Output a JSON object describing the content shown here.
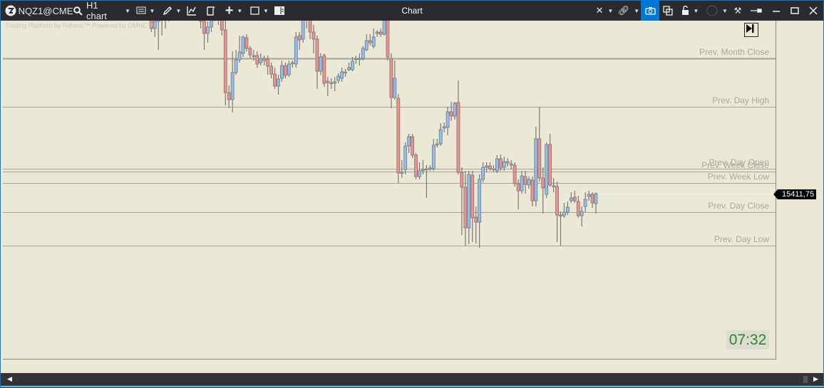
{
  "toolbar": {
    "symbol": "NQZ1@CME",
    "timeframe": "H1 chart",
    "title": "Chart"
  },
  "watermark": "Trading Platform by Rithmic™  Powered by OMNE™",
  "colors": {
    "up": "#90bef0",
    "down": "#f0908c",
    "outline": "#787878",
    "level": "#a4a39c",
    "background": "#ebe9d5",
    "titlebar": "#2b2b2f",
    "accent": "#0078d7",
    "clock": "#2a8a2a"
  },
  "levels": [
    {
      "label": "Prev. Month Close",
      "price": 15602
    },
    {
      "label": "Prev. Day High",
      "price": 15534
    },
    {
      "label": "Prev. Day Open",
      "price": 15447
    },
    {
      "label": "Prev. Week Close",
      "price": 15443
    },
    {
      "label": "Prev. Week Low",
      "price": 15427
    },
    {
      "label": "Prev. Day Close",
      "price": 15386
    },
    {
      "label": "Prev. Day Low",
      "price": 15339
    }
  ],
  "last_price": "15411,75",
  "clock": "07:32",
  "chart_data": {
    "type": "candlestick",
    "timeframe": "H1",
    "last": 15411.75,
    "ohlc": [
      [
        15664,
        15672,
        15639,
        15644
      ],
      [
        15644,
        15659,
        15632,
        15654
      ],
      [
        15654,
        15669,
        15614,
        15664
      ],
      [
        15664,
        15674,
        15634,
        15656
      ],
      [
        15656,
        15679,
        15644,
        15669
      ],
      [
        15669,
        15694,
        15654,
        15679
      ],
      [
        15679,
        15704,
        15664,
        15689
      ],
      [
        15689,
        15704,
        15669,
        15684
      ],
      [
        15684,
        15709,
        15674,
        15694
      ],
      [
        15694,
        15709,
        15674,
        15689
      ],
      [
        15689,
        15714,
        15679,
        15699
      ],
      [
        15699,
        15714,
        15679,
        15694
      ],
      [
        15694,
        15704,
        15669,
        15684
      ],
      [
        15684,
        15694,
        15659,
        15674
      ],
      [
        15674,
        15684,
        15644,
        15654
      ],
      [
        15654,
        15664,
        15614,
        15637
      ],
      [
        15637,
        15654,
        15624,
        15646
      ],
      [
        15646,
        15674,
        15639,
        15664
      ],
      [
        15664,
        15684,
        15654,
        15674
      ],
      [
        15674,
        15684,
        15649,
        15659
      ],
      [
        15659,
        15669,
        15634,
        15642
      ],
      [
        15642,
        15664,
        15536,
        15554
      ],
      [
        15554,
        15564,
        15532,
        15544
      ],
      [
        15544,
        15612,
        15526,
        15582
      ],
      [
        15582,
        15614,
        15579,
        15600
      ],
      [
        15600,
        15634,
        15596,
        15611
      ],
      [
        15609,
        15634,
        15604,
        15632
      ],
      [
        15631,
        15636,
        15612,
        15616
      ],
      [
        15616,
        15619,
        15602,
        15607
      ],
      [
        15606,
        15614,
        15599,
        15606
      ],
      [
        15606,
        15612,
        15589,
        15594
      ],
      [
        15596,
        15609,
        15592,
        15602
      ],
      [
        15602,
        15606,
        15592,
        15599
      ],
      [
        15601,
        15606,
        15579,
        15591
      ],
      [
        15591,
        15596,
        15574,
        15580
      ],
      [
        15580,
        15589,
        15559,
        15563
      ],
      [
        15563,
        15579,
        15551,
        15573
      ],
      [
        15574,
        15599,
        15569,
        15592
      ],
      [
        15592,
        15596,
        15574,
        15578
      ],
      [
        15579,
        15599,
        15576,
        15594
      ],
      [
        15595,
        15599,
        15589,
        15596
      ],
      [
        15594,
        15639,
        15589,
        15632
      ],
      [
        15634,
        15639,
        15614,
        15628
      ],
      [
        15629,
        15669,
        15624,
        15664
      ],
      [
        15664,
        15689,
        15644,
        15679
      ],
      [
        15664,
        15674,
        15629,
        15639
      ],
      [
        15639,
        15649,
        15609,
        15629
      ],
      [
        15629,
        15634,
        15559,
        15584
      ],
      [
        15584,
        15609,
        15579,
        15604
      ],
      [
        15606,
        15609,
        15562,
        15567
      ],
      [
        15570,
        15576,
        15549,
        15568
      ],
      [
        15568,
        15574,
        15559,
        15568
      ],
      [
        15567,
        15576,
        15556,
        15569
      ],
      [
        15571,
        15581,
        15567,
        15577
      ],
      [
        15574,
        15589,
        15569,
        15583
      ],
      [
        15582,
        15587,
        15576,
        15583
      ],
      [
        15586,
        15596,
        15584,
        15589
      ],
      [
        15586,
        15604,
        15584,
        15598
      ],
      [
        15602,
        15606,
        15594,
        15602
      ],
      [
        15602,
        15609,
        15592,
        15602
      ],
      [
        15602,
        15619,
        15599,
        15616
      ],
      [
        15614,
        15636,
        15612,
        15627
      ],
      [
        15627,
        15636,
        15620,
        15624
      ],
      [
        15619,
        15644,
        15616,
        15632
      ],
      [
        15637,
        15642,
        15632,
        15639
      ],
      [
        15639,
        15644,
        15632,
        15636
      ],
      [
        15636,
        15674,
        15634,
        15664
      ],
      [
        15664,
        15684,
        15599,
        15604
      ],
      [
        15602,
        15609,
        15532,
        15547
      ],
      [
        15547,
        15599,
        15544,
        15574
      ],
      [
        15546,
        15552,
        15427,
        15441
      ],
      [
        15441,
        15459,
        15434,
        15442
      ],
      [
        15446,
        15484,
        15439,
        15479
      ],
      [
        15479,
        15496,
        15469,
        15492
      ],
      [
        15492,
        15496,
        15462,
        15466
      ],
      [
        15466,
        15469,
        15432,
        15436
      ],
      [
        15436,
        15456,
        15432,
        15444
      ],
      [
        15446,
        15459,
        15439,
        15446
      ],
      [
        15447,
        15452,
        15406,
        15447
      ],
      [
        15447,
        15452,
        15444,
        15448
      ],
      [
        15447,
        15489,
        15444,
        15480
      ],
      [
        15482,
        15489,
        15477,
        15482
      ],
      [
        15482,
        15511,
        15479,
        15502
      ],
      [
        15504,
        15512,
        15498,
        15506
      ],
      [
        15505,
        15534,
        15494,
        15527
      ],
      [
        15527,
        15541,
        15514,
        15521
      ],
      [
        15521,
        15541,
        15516,
        15539
      ],
      [
        15540,
        15571,
        15439,
        15442
      ],
      [
        15442,
        15449,
        15354,
        15421
      ],
      [
        15421,
        15444,
        15339,
        15364
      ],
      [
        15364,
        15444,
        15341,
        15439
      ],
      [
        15438,
        15444,
        15344,
        15378
      ],
      [
        15379,
        15394,
        15342,
        15372
      ],
      [
        15372,
        15439,
        15336,
        15432
      ],
      [
        15432,
        15456,
        15428,
        15449
      ],
      [
        15449,
        15456,
        15442,
        15451
      ],
      [
        15451,
        15456,
        15444,
        15447
      ],
      [
        15447,
        15452,
        15442,
        15447
      ],
      [
        15444,
        15466,
        15441,
        15461
      ],
      [
        15461,
        15467,
        15444,
        15448
      ],
      [
        15449,
        15464,
        15444,
        15457
      ],
      [
        15457,
        15462,
        15450,
        15455
      ],
      [
        15454,
        15459,
        15446,
        15452
      ],
      [
        15452,
        15456,
        15422,
        15426
      ],
      [
        15426,
        15432,
        15390,
        15416
      ],
      [
        15416,
        15444,
        15412,
        15437
      ],
      [
        15436,
        15444,
        15412,
        15425
      ],
      [
        15424,
        15436,
        15419,
        15432
      ],
      [
        15431,
        15436,
        15394,
        15402
      ],
      [
        15402,
        15506,
        15394,
        15489
      ],
      [
        15489,
        15534,
        15429,
        15434
      ],
      [
        15434,
        15449,
        15384,
        15420
      ],
      [
        15411,
        15484,
        15406,
        15481
      ],
      [
        15481,
        15496,
        15422,
        15424
      ],
      [
        15423,
        15434,
        15414,
        15423
      ],
      [
        15422,
        15429,
        15344,
        15382
      ],
      [
        15382,
        15387,
        15339,
        15381
      ],
      [
        15381,
        15399,
        15378,
        15386
      ],
      [
        15386,
        15401,
        15382,
        15393
      ],
      [
        15402,
        15414,
        15399,
        15406
      ],
      [
        15407,
        15416,
        15399,
        15402
      ],
      [
        15401,
        15409,
        15378,
        15381
      ],
      [
        15381,
        15394,
        15366,
        15387
      ],
      [
        15394,
        15414,
        15386,
        15404
      ],
      [
        15408,
        15416,
        15402,
        15411
      ],
      [
        15411,
        15414,
        15392,
        15399
      ],
      [
        15398,
        15414,
        15384,
        15411.75
      ]
    ]
  }
}
